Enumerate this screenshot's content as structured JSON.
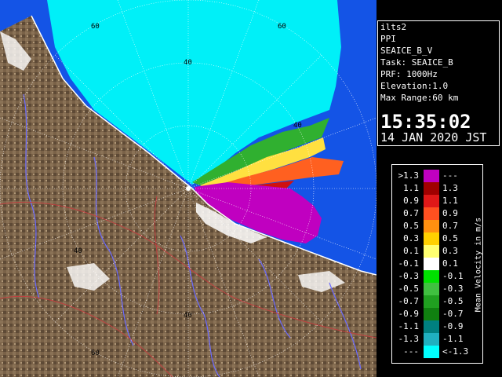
{
  "info": {
    "lines": [
      "ilts2",
      "PPI",
      "SEAICE_B_V",
      "Task: SEAICE_B",
      "PRF: 1000Hz",
      "Elevation:1.0",
      "Max Range:60 km"
    ],
    "time": "15:35:02",
    "date": "14 JAN 2020 JST"
  },
  "legend": {
    "title": "Mean Velocity in m/s",
    "rows": [
      {
        "lo": ">1.3",
        "hi": "---",
        "color": "#c000c0"
      },
      {
        "lo": "1.1",
        "hi": "1.3",
        "color": "#a00000"
      },
      {
        "lo": "0.9",
        "hi": "1.1",
        "color": "#e01818"
      },
      {
        "lo": "0.7",
        "hi": "0.9",
        "color": "#ff5020"
      },
      {
        "lo": "0.5",
        "hi": "0.7",
        "color": "#ff9010"
      },
      {
        "lo": "0.3",
        "hi": "0.5",
        "color": "#ffd000"
      },
      {
        "lo": "0.1",
        "hi": "0.3",
        "color": "#ffff70"
      },
      {
        "lo": "-0.1",
        "hi": "0.1",
        "color": "#ffffff"
      },
      {
        "lo": "-0.3",
        "hi": "-0.1",
        "color": "#00e000"
      },
      {
        "lo": "-0.5",
        "hi": "-0.3",
        "color": "#40c040"
      },
      {
        "lo": "-0.7",
        "hi": "-0.5",
        "color": "#20a020"
      },
      {
        "lo": "-0.9",
        "hi": "-0.7",
        "color": "#108010"
      },
      {
        "lo": "-1.1",
        "hi": "-0.9",
        "color": "#008080"
      },
      {
        "lo": "-1.3",
        "hi": "-1.1",
        "color": "#20b0c0"
      },
      {
        "lo": "---",
        "hi": "<-1.3",
        "color": "#00ffff"
      }
    ]
  },
  "map": {
    "range_labels": [
      "60",
      "60",
      "40",
      "40",
      "40",
      "40",
      "60"
    ],
    "colors": {
      "land": "#7a6248",
      "sea": "#1454e6",
      "river": "#6a6aff",
      "border": "#c04040",
      "coast_line": "#ffffff"
    }
  }
}
